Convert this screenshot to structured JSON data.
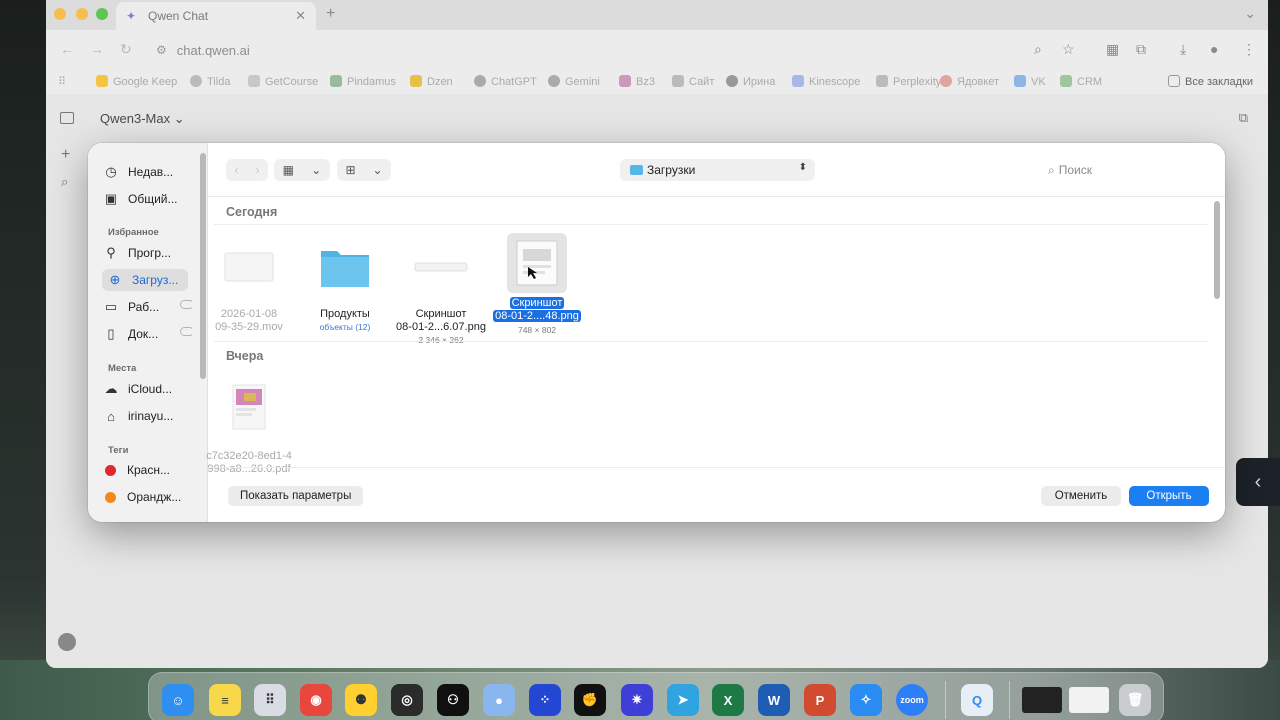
{
  "browser": {
    "tab_title": "Qwen Chat",
    "url": "chat.qwen.ai",
    "bookmarks": [
      "Google Keep",
      "Tilda",
      "GetCourse",
      "Pindamus",
      "Dzen",
      "ChatGPT",
      "Gemini",
      "Bz3",
      "Сайт",
      "Ирина",
      "Kinescope",
      "Perplexity",
      "Ядовкет",
      "VK",
      "CRM"
    ],
    "all_bookmarks": "Все закладки"
  },
  "page": {
    "model_label": "Qwen3-Max",
    "model_chevron": "⌄"
  },
  "dialog": {
    "sidebar": {
      "items": [
        {
          "label": "Недав...",
          "icon": "clock-icon",
          "glyph": "◷"
        },
        {
          "label": "Общий...",
          "icon": "shared-folder-icon",
          "glyph": "▣"
        }
      ],
      "favorites_title": "Избранное",
      "favorites": [
        {
          "label": "Прогр...",
          "icon": "applications-icon",
          "glyph": "⚲"
        },
        {
          "label": "Загруз...",
          "icon": "downloads-icon",
          "glyph": "⊕",
          "active": true
        },
        {
          "label": "Раб...",
          "icon": "desktop-icon",
          "glyph": "▭"
        },
        {
          "label": "Док...",
          "icon": "documents-icon",
          "glyph": "▯"
        }
      ],
      "places_title": "Места",
      "places": [
        {
          "label": "iCloud...",
          "icon": "icloud-icon",
          "glyph": "☁"
        },
        {
          "label": "irinayu...",
          "icon": "home-icon",
          "glyph": "⌂"
        }
      ],
      "tags_title": "Теги",
      "tags": [
        {
          "label": "Красн...",
          "color": "#e0262e"
        },
        {
          "label": "Орандж...",
          "color": "#f08a1d"
        }
      ]
    },
    "toolbar": {
      "location": "Загрузки",
      "search_placeholder": "Поиск"
    },
    "sections": [
      {
        "title": "Сегодня",
        "files": [
          {
            "name_line1": "2026-01-08",
            "name_line2": "09-35-29.mov",
            "meta": "",
            "kind": "video",
            "dim": true
          },
          {
            "name_line1": "Продукты",
            "name_line2": "",
            "meta": "объекты (12)",
            "kind": "folder"
          },
          {
            "name_line1": "Скриншот",
            "name_line2": "08-01-2...6.07.png",
            "meta": "2 346 × 262",
            "kind": "image-wide"
          },
          {
            "name_line1": "Скриншот",
            "name_line2": "08-01-2....48.png",
            "meta": "748 × 802",
            "kind": "image-doc",
            "selected": true
          }
        ]
      },
      {
        "title": "Вчера",
        "files": [
          {
            "name_line1": "c7c32e20-8ed1-4",
            "name_line2": "998-a8...26.0.pdf",
            "meta": "",
            "kind": "pdf",
            "dim": true
          }
        ]
      }
    ],
    "footer": {
      "options_label": "Показать параметры",
      "cancel_label": "Отменить",
      "open_label": "Открыть"
    }
  },
  "dock": {
    "apps": [
      {
        "name": "finder",
        "color": "#2f8ff0",
        "glyph": "☺"
      },
      {
        "name": "notes",
        "color": "#f7d84a",
        "glyph": "≡"
      },
      {
        "name": "launchpad",
        "color": "#d9dde3",
        "glyph": "⠿"
      },
      {
        "name": "chrome",
        "color": "#e8473d",
        "glyph": "◉"
      },
      {
        "name": "miro",
        "color": "#ffd02f",
        "glyph": "⚉"
      },
      {
        "name": "obs",
        "color": "#2b2b2b",
        "glyph": "◎"
      },
      {
        "name": "app-green",
        "color": "#101010",
        "glyph": "⚇"
      },
      {
        "name": "app-blue",
        "color": "#8ab6f0",
        "glyph": "●"
      },
      {
        "name": "app-dots",
        "color": "#2346d3",
        "glyph": "⁘"
      },
      {
        "name": "github",
        "color": "#111",
        "glyph": "✊"
      },
      {
        "name": "gear-app",
        "color": "#3d3fd6",
        "glyph": "✷"
      },
      {
        "name": "telegram",
        "color": "#2fa4e0",
        "glyph": "➤"
      },
      {
        "name": "excel",
        "color": "#1d7a45",
        "glyph": "X"
      },
      {
        "name": "word",
        "color": "#1f5db4",
        "glyph": "W"
      },
      {
        "name": "powerpoint",
        "color": "#d24a2f",
        "glyph": "P"
      },
      {
        "name": "safari",
        "color": "#2a8cf3",
        "glyph": "✧"
      },
      {
        "name": "zoom",
        "color": "#2d7ff9",
        "glyph": "zoom"
      },
      {
        "name": "qq-app",
        "color": "#e8eef5",
        "glyph": "Q"
      },
      {
        "name": "window-thumb-1",
        "color": "#222",
        "glyph": ""
      },
      {
        "name": "window-thumb-2",
        "color": "#f2f2f2",
        "glyph": ""
      },
      {
        "name": "trash",
        "color": "#c9cdd0",
        "glyph": "🗑"
      }
    ]
  }
}
